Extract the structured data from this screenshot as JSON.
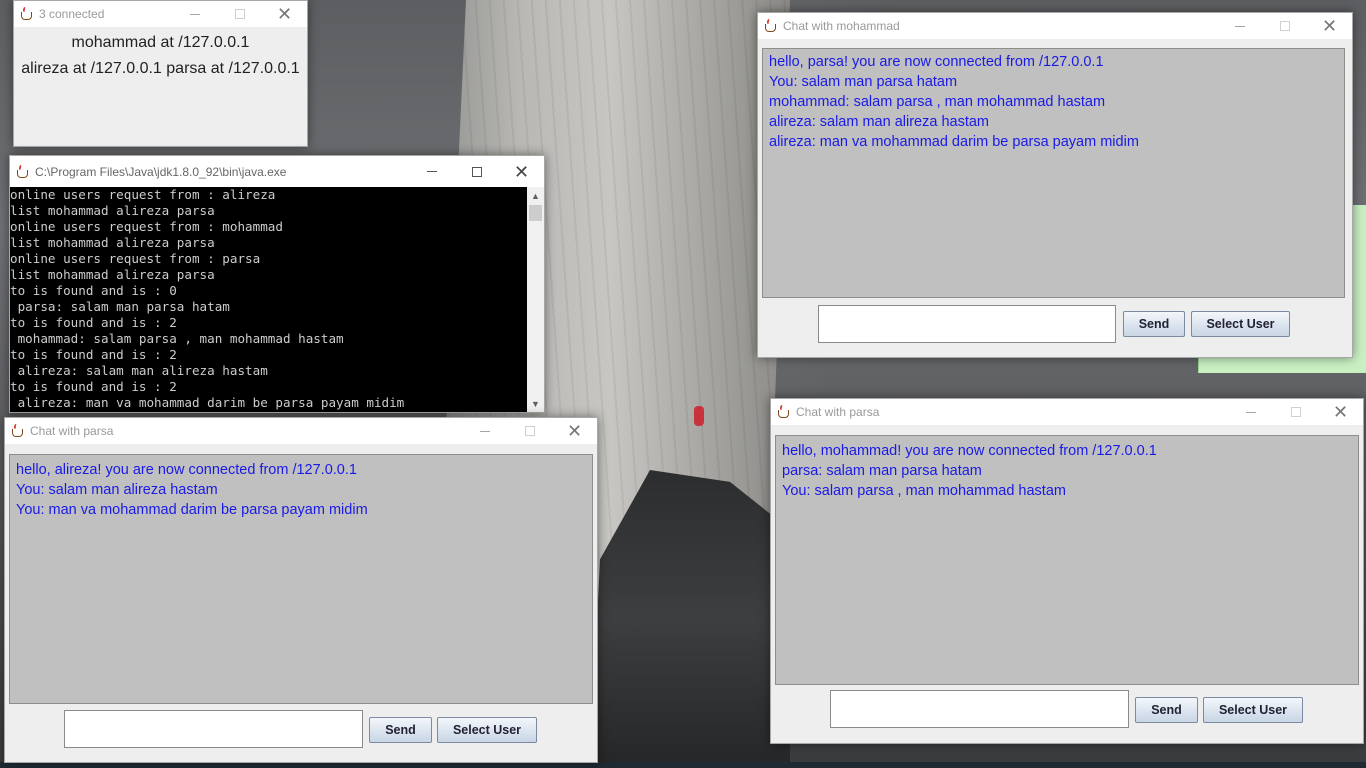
{
  "windows": {
    "connected": {
      "title": "3 connected",
      "lines": [
        "mohammad at  /127.0.0.1",
        "alireza at  /127.0.0.1 parsa at  /127.0.0.1"
      ]
    },
    "console": {
      "title": "C:\\Program Files\\Java\\jdk1.8.0_92\\bin\\java.exe",
      "lines": [
        "online users request from : alireza",
        "list mohammad alireza parsa",
        "online users request from : mohammad",
        "list mohammad alireza parsa",
        "online users request from : parsa",
        "list mohammad alireza parsa",
        "to is found and is : 0",
        " parsa: salam man parsa hatam",
        "to is found and is : 2",
        " mohammad: salam parsa , man mohammad hastam",
        "to is found and is : 2",
        " alireza: salam man alireza hastam",
        "to is found and is : 2",
        " alireza: man va mohammad darim be parsa payam midim"
      ]
    },
    "chat_mohammad": {
      "title": "Chat with mohammad",
      "messages": [
        "hello, parsa! you are now connected from /127.0.0.1",
        "You: salam man parsa hatam",
        "mohammad: salam parsa , man mohammad hastam",
        "alireza: salam man alireza hastam",
        "alireza: man va mohammad darim be parsa payam midim"
      ],
      "input_value": "",
      "send_label": "Send",
      "select_user_label": "Select User"
    },
    "chat_parsa_alireza": {
      "title": "Chat with parsa",
      "messages": [
        "hello, alireza! you are now connected from /127.0.0.1",
        "You: salam man alireza hastam",
        "You: man va mohammad darim be parsa payam midim"
      ],
      "input_value": "",
      "send_label": "Send",
      "select_user_label": "Select User"
    },
    "chat_parsa_mohammad": {
      "title": "Chat with parsa",
      "messages": [
        "hello, mohammad! you are now connected from /127.0.0.1",
        "parsa: salam man parsa hatam",
        "You: salam parsa , man mohammad hastam"
      ],
      "input_value": "",
      "send_label": "Send",
      "select_user_label": "Select User"
    }
  },
  "colors": {
    "chat_text": "#1a1ae6",
    "chat_background": "#c0c0c0",
    "console_background": "#000000",
    "console_text": "#cccccc"
  },
  "icons": {
    "title_icon": "java-cup-icon",
    "minimize": "minimize-icon",
    "maximize": "maximize-icon",
    "close": "close-icon"
  }
}
